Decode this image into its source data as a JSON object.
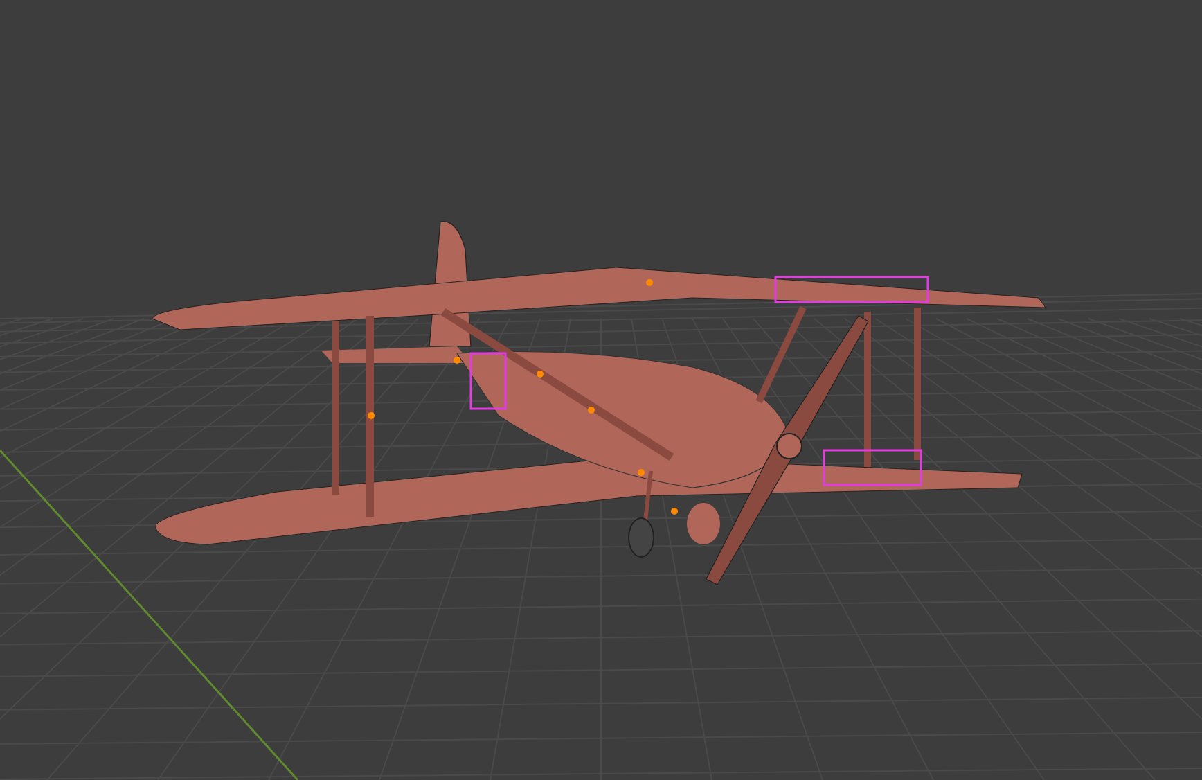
{
  "viewport": {
    "grid": true,
    "axis_line": true
  }
}
